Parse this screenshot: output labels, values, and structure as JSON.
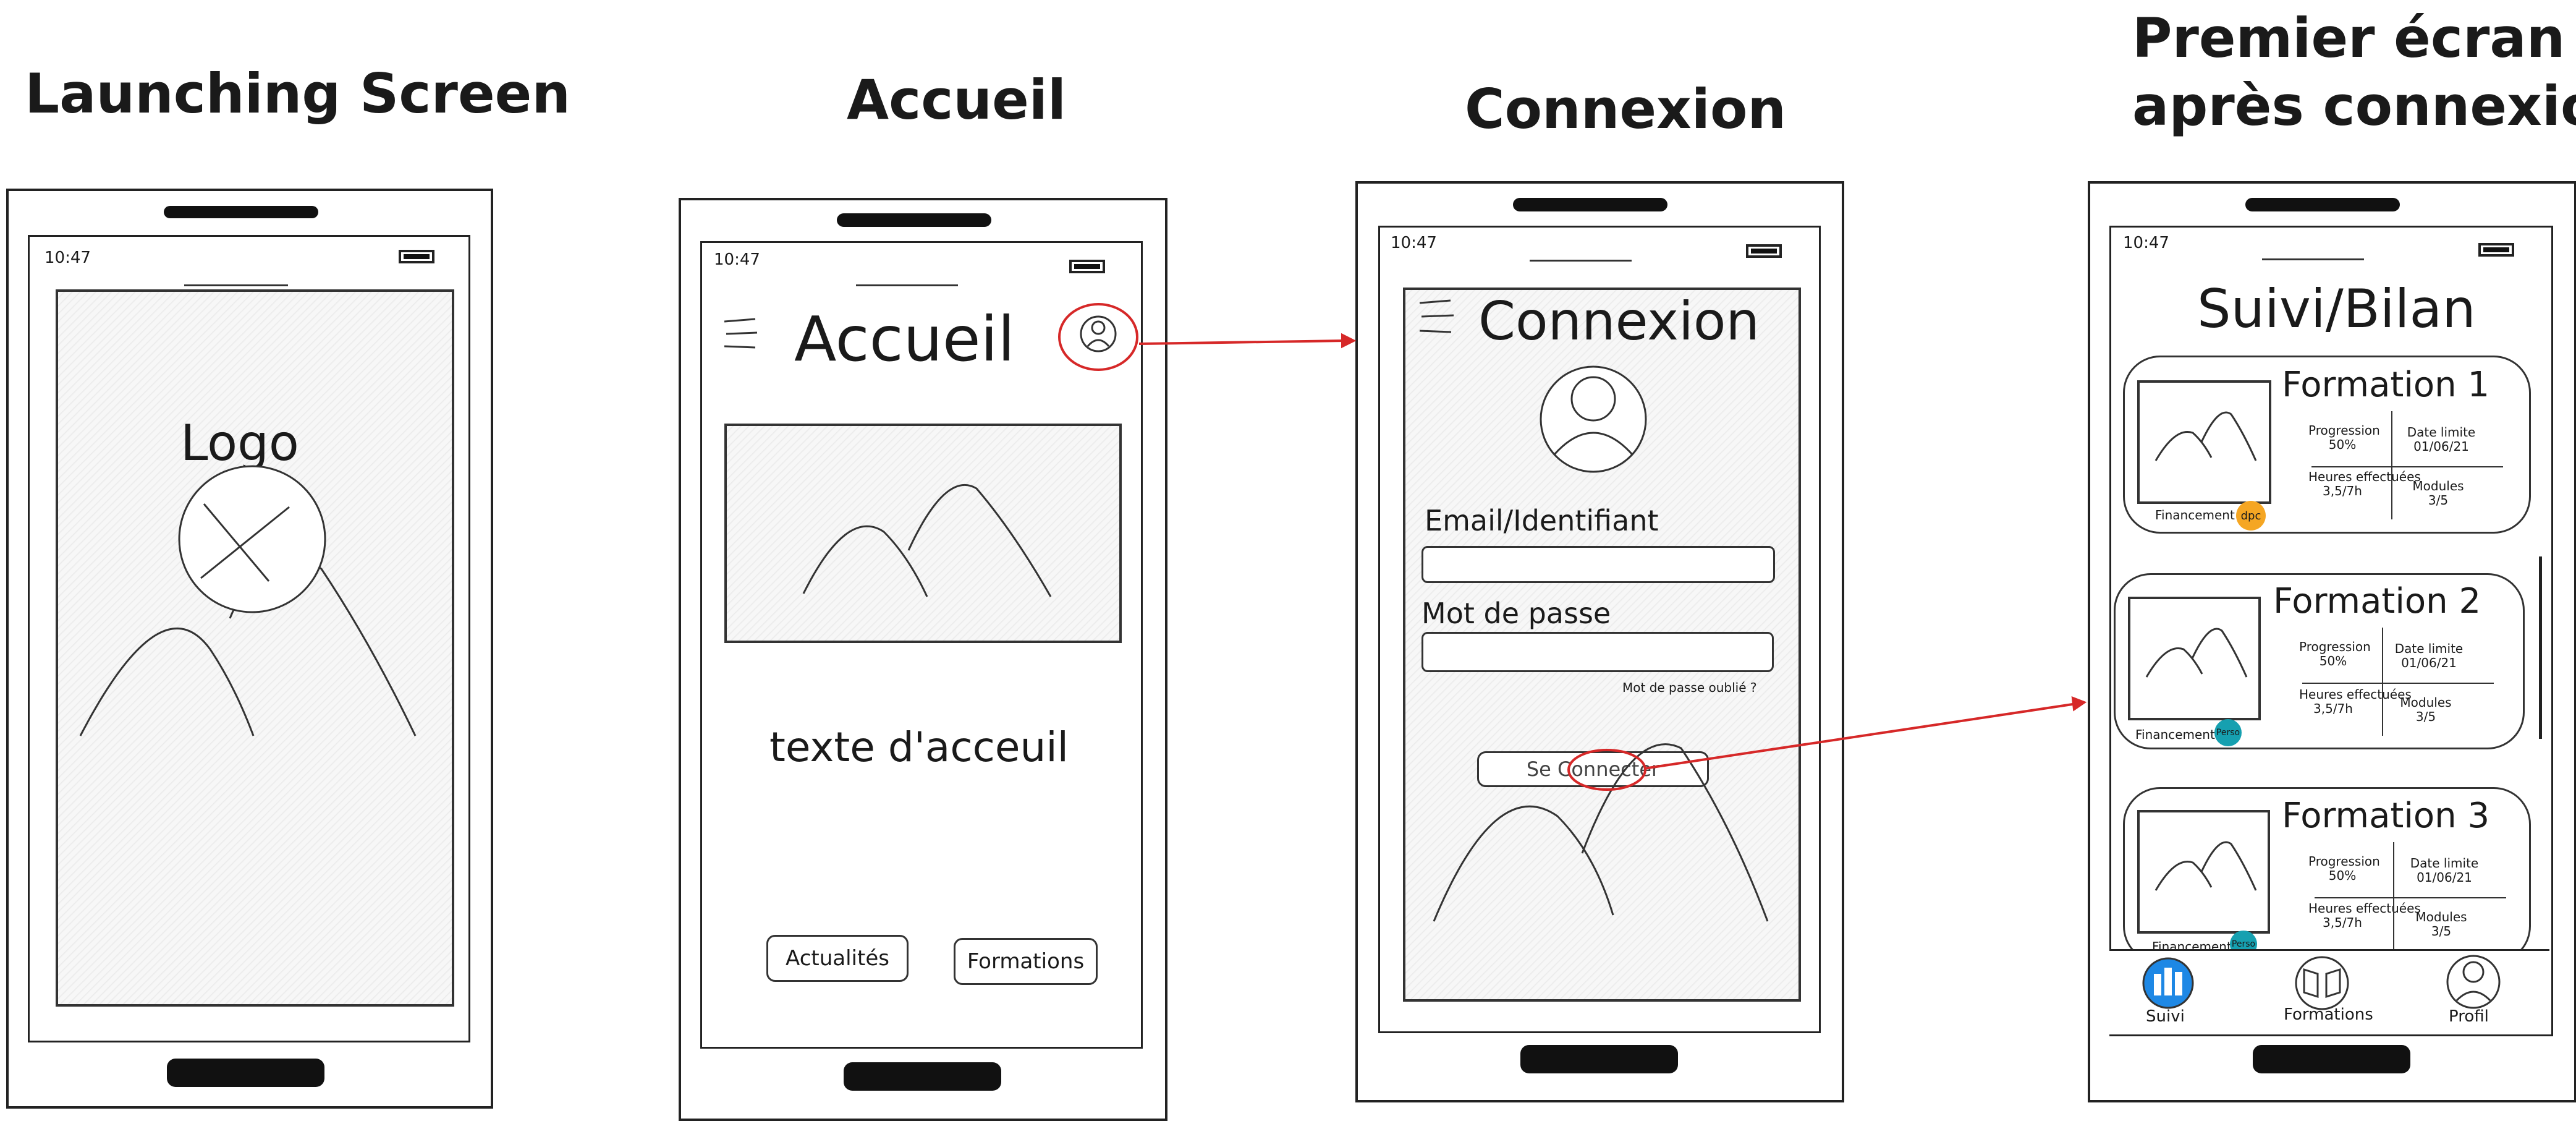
{
  "titles": {
    "launching": "Launching Screen",
    "accueil": "Accueil",
    "connexion": "Connexion",
    "premier_line1": "Premier écran",
    "premier_line2": "après connexion"
  },
  "status_time": "10:47",
  "launch": {
    "logo_label": "Logo"
  },
  "accueil_screen": {
    "title": "Accueil",
    "welcome_text": "texte d'acceuil",
    "btn_actualites": "Actualités",
    "btn_formations": "Formations"
  },
  "connexion_screen": {
    "title": "Connexion",
    "email_label": "Email/Identifiant",
    "password_label": "Mot de passe",
    "forgot": "Mot de passe oublié ?",
    "connect_button": "Se Connecter"
  },
  "suivi_screen": {
    "title": "Suivi/Bilan",
    "cards": [
      {
        "title": "Formation 1",
        "progress_label": "Progression",
        "progress": "50%",
        "deadline_label": "Date limite",
        "deadline": "01/06/21",
        "hours_label": "Heures effectuées",
        "hours": "3,5/7h",
        "modules_label": "Modules",
        "modules": "3/5",
        "funding_label": "Financement",
        "funding_badge": "dpc",
        "badge_color": "#f5a623"
      },
      {
        "title": "Formation 2",
        "progress_label": "Progression",
        "progress": "50%",
        "deadline_label": "Date limite",
        "deadline": "01/06/21",
        "hours_label": "Heures effectuées",
        "hours": "3,5/7h",
        "modules_label": "Modules",
        "modules": "3/5",
        "funding_label": "Financement",
        "funding_badge": "Perso",
        "badge_color": "#16a0b0"
      },
      {
        "title": "Formation 3",
        "progress_label": "Progression",
        "progress": "50%",
        "deadline_label": "Date limite",
        "deadline": "01/06/21",
        "hours_label": "Heures effectuées",
        "hours": "3,5/7h",
        "modules_label": "Modules",
        "modules": "3/5",
        "funding_label": "Financement",
        "funding_badge": "Perso",
        "badge_color": "#16a0b0"
      }
    ],
    "nav": {
      "suivi": "Suivi",
      "formations": "Formations",
      "profil": "Profil"
    }
  },
  "colors": {
    "annotation_red": "#d62828",
    "nav_active": "#1e88e5"
  }
}
